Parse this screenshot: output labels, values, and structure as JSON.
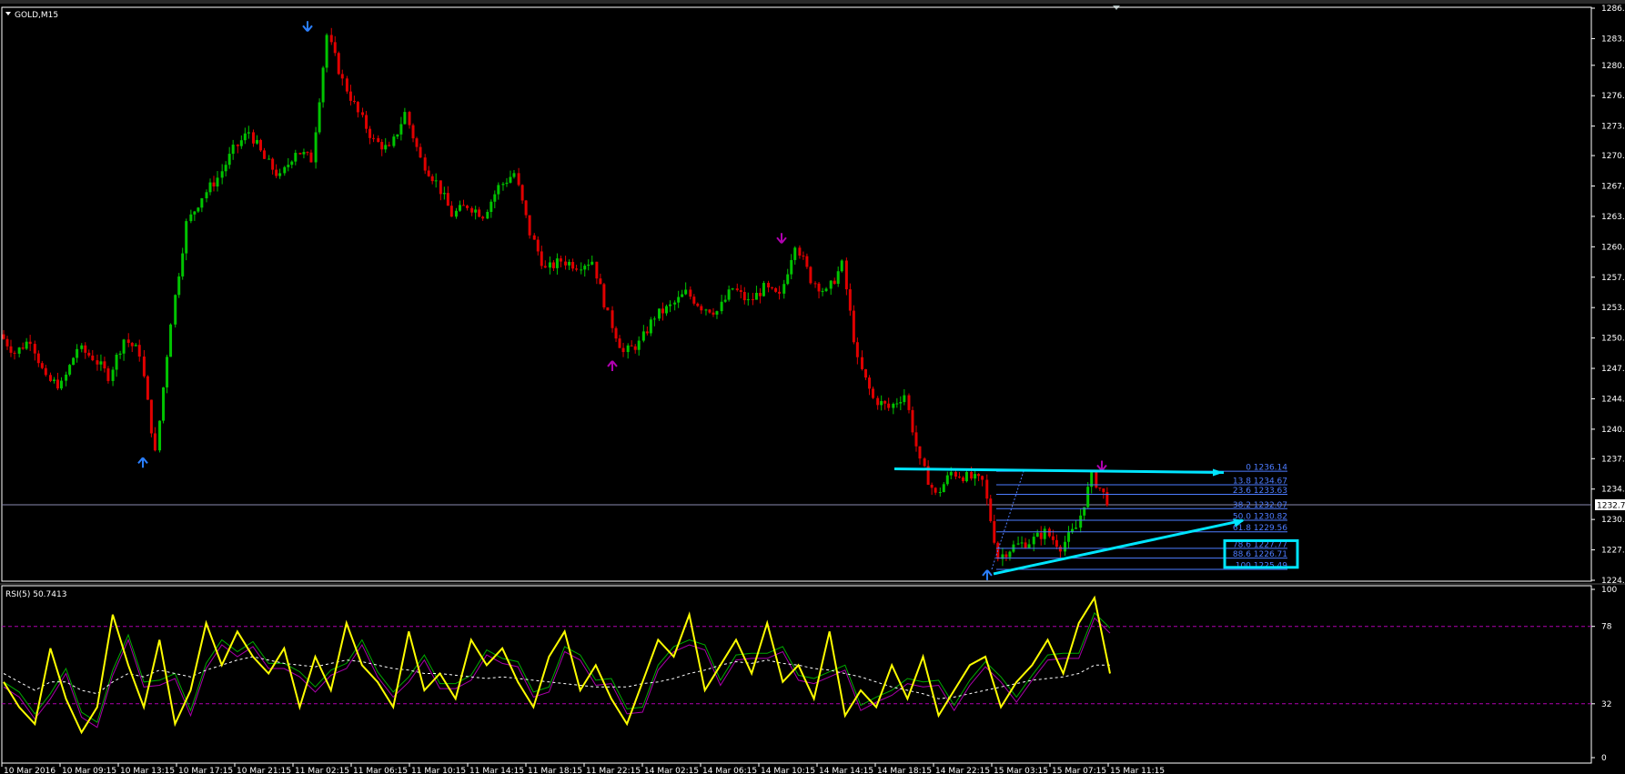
{
  "main_panel": {
    "title": "GOLD,M15",
    "current_price_tag": "1232.7"
  },
  "rsi_panel": {
    "title": "RSI(5) 50.7413",
    "levels": [
      "100",
      "78",
      "32",
      "0"
    ]
  },
  "colors": {
    "background": "#000000",
    "bull": "#00c400",
    "bear": "#e00000",
    "grid": "#ffffff",
    "fib": "#4d7cff",
    "trendline": "#00e5ff",
    "rsi": "#ffff00",
    "rsi_signal": "#00aa00",
    "rsi_slow": "#aa00aa",
    "fractal_up": "#2a7fff",
    "fractal_down": "#b000b0"
  },
  "chart_data": [
    {
      "type": "candlestick",
      "title": "GOLD,M15",
      "x_tick_labels": [
        "10 Mar 2016",
        "10 Mar 09:15",
        "10 Mar 13:15",
        "10 Mar 17:15",
        "10 Mar 21:15",
        "11 Mar 02:15",
        "11 Mar 06:15",
        "11 Mar 10:15",
        "11 Mar 14:15",
        "11 Mar 18:15",
        "11 Mar 22:15",
        "14 Mar 02:15",
        "14 Mar 06:15",
        "14 Mar 10:15",
        "14 Mar 14:15",
        "14 Mar 18:15",
        "14 Mar 22:15",
        "15 Mar 03:15",
        "15 Mar 07:15",
        "15 Mar 11:15"
      ],
      "y_tick_labels": [
        "1286.4",
        "1283.1",
        "1280.2",
        "1276.9",
        "1273.6",
        "1270.4",
        "1267.1",
        "1263.8",
        "1260.5",
        "1257.2",
        "1253.9",
        "1250.6",
        "1247.3",
        "1244.0",
        "1240.7",
        "1237.5",
        "1234.2",
        "1230.9",
        "1227.6",
        "1224.3"
      ],
      "ylim": [
        1224.3,
        1286.4
      ],
      "close_path": [
        1251.0,
        1249.0,
        1250.5,
        1246.0,
        1245.5,
        1249.5,
        1248.5,
        1246.5,
        1250.5,
        1249.0,
        1238.0,
        1252.5,
        1263.0,
        1266.0,
        1268.0,
        1271.0,
        1273.0,
        1270.0,
        1268.0,
        1271.0,
        1270.0,
        1283.5,
        1278.5,
        1275.0,
        1272.0,
        1271.0,
        1275.0,
        1270.0,
        1267.5,
        1264.0,
        1265.0,
        1264.0,
        1267.0,
        1268.5,
        1262.0,
        1258.0,
        1259.0,
        1258.5,
        1259.0,
        1253.0,
        1249.0,
        1250.0,
        1253.0,
        1254.0,
        1255.5,
        1254.0,
        1253.5,
        1256.0,
        1254.5,
        1256.0,
        1255.0,
        1261.0,
        1257.0,
        1255.5,
        1258.5,
        1248.0,
        1244.0,
        1243.0,
        1244.5,
        1237.0,
        1233.5,
        1236.0,
        1235.5,
        1235.0,
        1226.8,
        1228.0,
        1228.5,
        1229.5,
        1228.0,
        1230.0,
        1235.5,
        1233.0
      ],
      "fibonacci": [
        {
          "level": "0",
          "price": "1236.14"
        },
        {
          "level": "13.8",
          "price": "1234.67"
        },
        {
          "level": "23.6",
          "price": "1233.63"
        },
        {
          "level": "38.2",
          "price": "1232.07"
        },
        {
          "level": "50.0",
          "price": "1230.82"
        },
        {
          "level": "61.8",
          "price": "1229.56"
        },
        {
          "level": "78.6",
          "price": "1227.77"
        },
        {
          "level": "88.6",
          "price": "1226.71"
        },
        {
          "level": "100",
          "price": "1225.49"
        }
      ],
      "fractals": [
        {
          "kind": "up",
          "price": 1237.5
        },
        {
          "kind": "down",
          "price": 1284.0
        },
        {
          "kind": "up",
          "price": 1248.0
        },
        {
          "kind": "down",
          "price": 1261.0
        },
        {
          "kind": "up",
          "price": 1225.3
        },
        {
          "kind": "down",
          "price": 1236.3
        }
      ],
      "trendlines": [
        "resistance",
        "support"
      ]
    },
    {
      "type": "line",
      "title": "RSI(5) 50.7413",
      "ylim": [
        0,
        100
      ],
      "y_tick_labels": [
        "100",
        "78",
        "32",
        "0"
      ],
      "levels": [
        78,
        32
      ],
      "series": [
        {
          "values": [
            45,
            30,
            20,
            65,
            35,
            15,
            30,
            85,
            55,
            30,
            70,
            20,
            40,
            80,
            55,
            75,
            60,
            50,
            65,
            30,
            60,
            40,
            80,
            55,
            45,
            30,
            75,
            40,
            50,
            35,
            70,
            55,
            65,
            45,
            30,
            60,
            75,
            40,
            55,
            35,
            20,
            45,
            70,
            60,
            85,
            40,
            55,
            70,
            50,
            80,
            45,
            55,
            35,
            75,
            25,
            40,
            30,
            55,
            35,
            60,
            25,
            40,
            55,
            60,
            30,
            45,
            55,
            70,
            50,
            80,
            95,
            50
          ]
        },
        {
          "values": [
            50,
            45,
            40,
            45,
            45,
            40,
            38,
            45,
            50,
            48,
            52,
            50,
            48,
            52,
            55,
            58,
            60,
            58,
            56,
            55,
            54,
            56,
            58,
            57,
            55,
            53,
            52,
            50,
            50,
            49,
            48,
            47,
            48,
            47,
            46,
            45,
            44,
            43,
            42,
            42,
            42,
            44,
            45,
            47,
            50,
            52,
            55,
            57,
            56,
            58,
            56,
            55,
            53,
            52,
            50,
            48,
            45,
            42,
            40,
            38,
            35,
            36,
            38,
            40,
            42,
            44,
            46,
            47,
            48,
            50,
            55,
            55
          ]
        }
      ]
    }
  ]
}
